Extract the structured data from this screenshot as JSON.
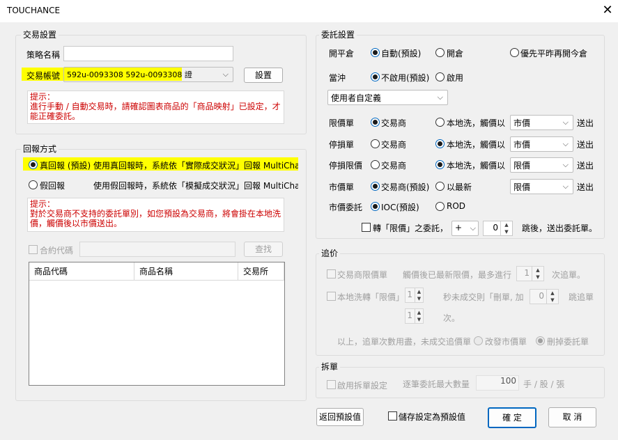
{
  "window": {
    "title": "TOUCHANCE"
  },
  "trade_settings": {
    "group_label": "交易設置",
    "strategy_name_label": "策略名稱",
    "strategy_name_value": "",
    "account_label": "交易帳號",
    "account_value": "592u-0093308 592u-0093308 證",
    "settings_button": "設置",
    "hint": "提示：\n進行手動 / 自動交易時，請確認圖表商品的「商品映射」已設定，才能正確委託。"
  },
  "report_mode": {
    "group_label": "回報方式",
    "real_label": "真回報 (預設)",
    "real_desc": "使用真回報時，系統依「實際成交狀況」回報 MultiCharts",
    "fake_label": "假回報",
    "fake_desc": "使用假回報時，系統依「模擬成交狀況」回報 MultiCharts",
    "hint": "提示：\n對於交易商不支持的委託單別，如您預設為交易商，將會掛在本地洗價，觸價後以市價送出。",
    "contract_code_label": "合約代碼",
    "search_button": "查找",
    "table_headers": [
      "商品代碼",
      "商品名稱",
      "交易所"
    ]
  },
  "order_settings": {
    "group_label": "委託設置",
    "open_close_label": "開平倉",
    "open_close_options": [
      "自動(預設)",
      "開倉",
      "優先平昨再開今倉"
    ],
    "day_trade_label": "當沖",
    "day_trade_options": [
      "不啟用(預設)",
      "啟用"
    ],
    "user_defined": "使用者自定義",
    "limit_label": "限價單",
    "stop_label": "停損單",
    "stop_limit_label": "停損限價",
    "market_label": "市價單",
    "market_tif_label": "市價委託",
    "broker": "交易商",
    "broker_default": "交易商(預設)",
    "local_wash": "本地洗，觸價以",
    "use_latest": "以最新",
    "send": "送出",
    "limit_combo": "市價",
    "stop_combo": "市價",
    "stop_limit_combo": "限價",
    "market_combo": "限價",
    "tif_options": [
      "IOC(預設)",
      "ROD"
    ],
    "convert_label": "轉「限價」之委託，",
    "convert_sign": "+",
    "convert_ticks": "0",
    "convert_suffix": "跳後，送出委託單。"
  },
  "chase": {
    "group_label": "追价",
    "broker_limit_label": "交易商限價單",
    "broker_limit_desc": "觸價後已最新限價，最多進行",
    "broker_limit_count": "1",
    "broker_limit_suffix": "次追單。",
    "local_to_limit_label": "本地洗轉「限價」",
    "local_to_limit_seconds": "1",
    "local_to_limit_desc": "秒未成交則「刪單, 加",
    "local_to_limit_ticks": "0",
    "local_to_limit_suffix": "跳追單",
    "times_value": "1",
    "times_suffix": "次。",
    "exhaust_label": "以上，追單次數用盡，未成交追價單",
    "exhaust_options": [
      "改發市價單",
      "刪掉委託單"
    ]
  },
  "split": {
    "group_label": "拆單",
    "enable_label": "啟用拆單設定",
    "max_label": "逐筆委託最大數量",
    "max_value": "100",
    "unit": "手 / 股 / 張"
  },
  "footer": {
    "reset_button": "返回預設值",
    "save_default_label": "儲存設定為預設值",
    "ok_button": "確 定",
    "cancel_button": "取 消"
  }
}
